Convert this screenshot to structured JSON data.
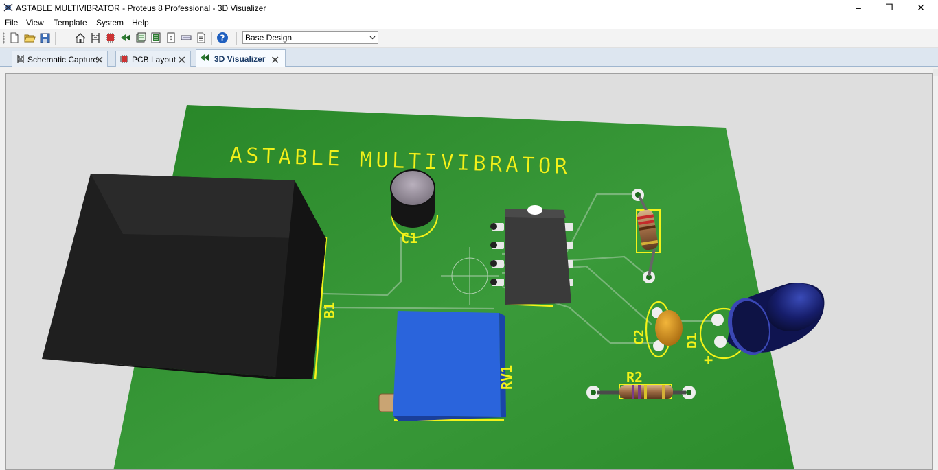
{
  "window": {
    "title": "ASTABLE MULTIVIBRATOR - Proteus 8 Professional - 3D Visualizer",
    "controls": {
      "minimize": "–",
      "restore": "❐",
      "close": "✕"
    }
  },
  "menu": [
    "File",
    "View",
    "Template",
    "System",
    "Help"
  ],
  "toolbar": {
    "buttons": [
      "new-file-icon",
      "open-folder-icon",
      "save-icon",
      "home-icon",
      "schematic-icon",
      "pcb-icon",
      "visualizer-icon",
      "gerber-icon",
      "bom-icon",
      "pinout-icon",
      "notes-icon",
      "help-icon"
    ],
    "variant_dropdown": {
      "selected": "Base Design"
    }
  },
  "tabs": [
    {
      "label": "Schematic Capture",
      "active": false
    },
    {
      "label": "PCB Layout",
      "active": false
    },
    {
      "label": "3D Visualizer",
      "active": true
    }
  ],
  "board": {
    "title_silkscreen": "ASTABLE MULTIVIBRATOR",
    "refdes": {
      "battery": "B1",
      "cap1": "C1",
      "cap2": "C2",
      "pot": "RV1",
      "diode": "D1",
      "res2": "R2",
      "led_polarity": "+"
    },
    "colors": {
      "pcb": "#2f8f2f",
      "silkscreen": "#f2f21a",
      "trace": "#8fbf8f"
    }
  }
}
